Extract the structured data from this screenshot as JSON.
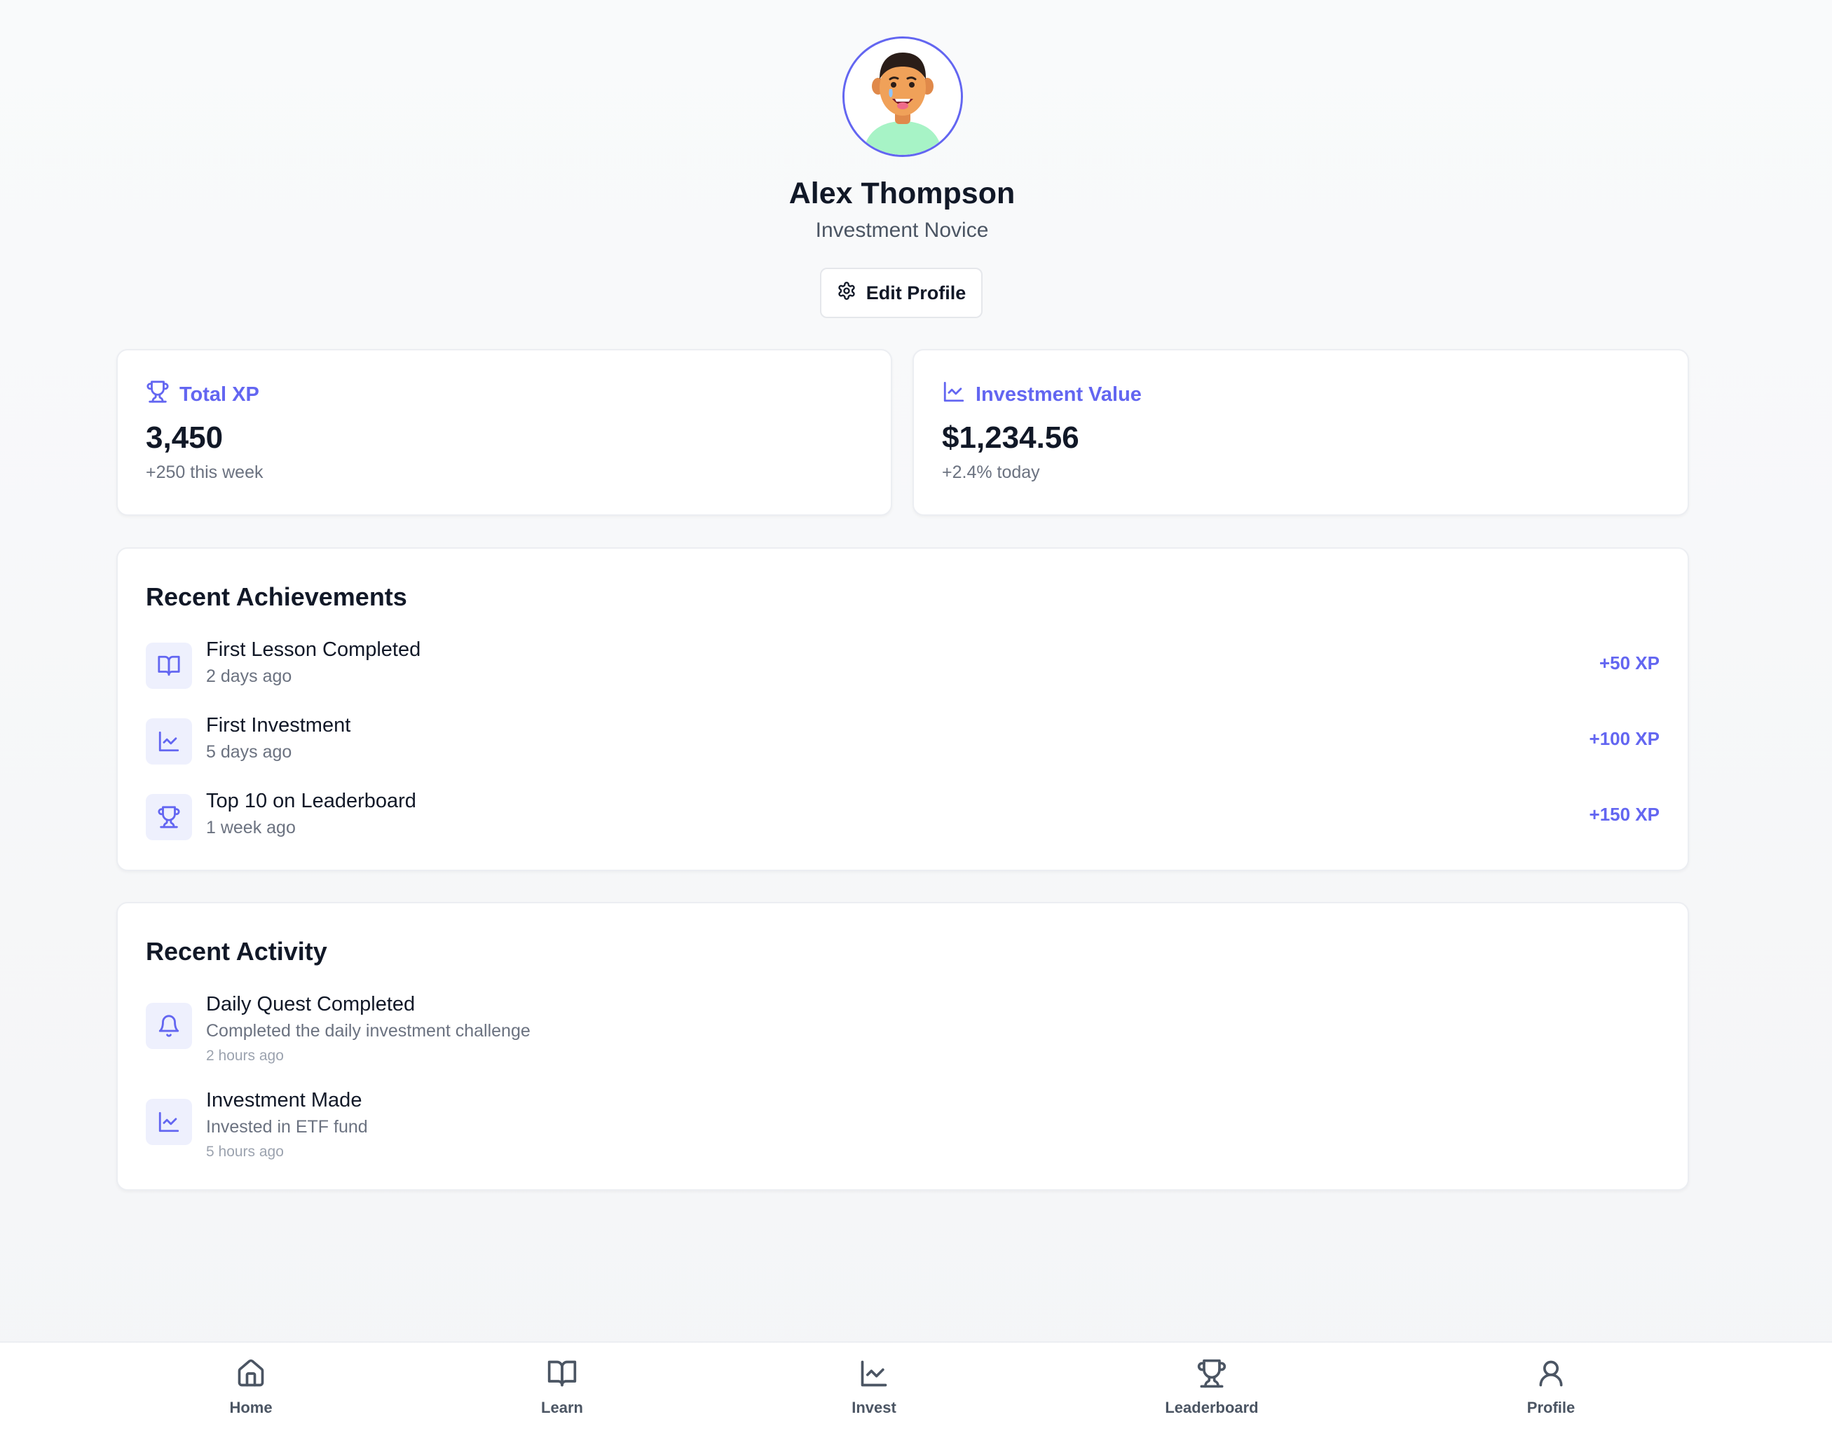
{
  "profile": {
    "name": "Alex Thompson",
    "role": "Investment Novice",
    "edit_label": "Edit Profile",
    "accent_color": "#6366f1"
  },
  "stats": {
    "xp": {
      "label": "Total XP",
      "value": "3,450",
      "sub": "+250 this week",
      "icon": "trophy-icon"
    },
    "investment": {
      "label": "Investment Value",
      "value": "$1,234.56",
      "sub": "+2.4% today",
      "icon": "chart-line-icon"
    }
  },
  "achievements": {
    "title": "Recent Achievements",
    "items": [
      {
        "title": "First Lesson Completed",
        "time": "2 days ago",
        "xp": "+50 XP",
        "icon": "book-icon"
      },
      {
        "title": "First Investment",
        "time": "5 days ago",
        "xp": "+100 XP",
        "icon": "chart-line-icon"
      },
      {
        "title": "Top 10 on Leaderboard",
        "time": "1 week ago",
        "xp": "+150 XP",
        "icon": "trophy-icon"
      }
    ]
  },
  "activity": {
    "title": "Recent Activity",
    "items": [
      {
        "title": "Daily Quest Completed",
        "desc": "Completed the daily investment challenge",
        "time": "2 hours ago",
        "icon": "bell-icon"
      },
      {
        "title": "Investment Made",
        "desc": "Invested in ETF fund",
        "time": "5 hours ago",
        "icon": "chart-line-icon"
      }
    ]
  },
  "nav": {
    "items": [
      {
        "label": "Home",
        "icon": "home-icon"
      },
      {
        "label": "Learn",
        "icon": "book-icon"
      },
      {
        "label": "Invest",
        "icon": "chart-line-icon"
      },
      {
        "label": "Leaderboard",
        "icon": "trophy-icon"
      },
      {
        "label": "Profile",
        "icon": "user-icon"
      }
    ]
  }
}
